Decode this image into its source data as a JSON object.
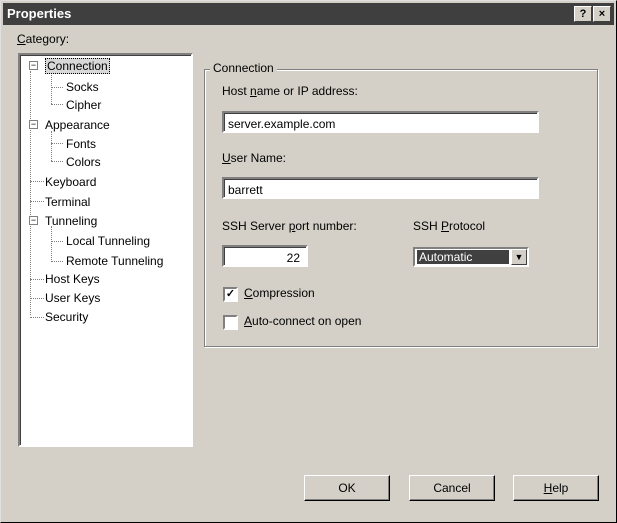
{
  "window": {
    "title": "Properties",
    "help_label": "?",
    "close_label": "×"
  },
  "category": {
    "label_mnemonic": "C",
    "label_rest": "ategory:",
    "items": [
      {
        "label": "Connection",
        "expander": "−"
      },
      {
        "label": "Socks"
      },
      {
        "label": "Cipher"
      },
      {
        "label": "Appearance",
        "expander": "−"
      },
      {
        "label": "Fonts"
      },
      {
        "label": "Colors"
      },
      {
        "label": "Keyboard"
      },
      {
        "label": "Terminal"
      },
      {
        "label": "Tunneling",
        "expander": "−"
      },
      {
        "label": "Local Tunneling"
      },
      {
        "label": "Remote Tunneling"
      },
      {
        "label": "Host Keys"
      },
      {
        "label": "User Keys"
      },
      {
        "label": "Security"
      }
    ],
    "selected": "Connection"
  },
  "connection": {
    "group_title": "Connection",
    "host_label_a": "Host ",
    "host_label_mn": "n",
    "host_label_b": "ame or IP address:",
    "host_value": "server.example.com",
    "user_label_mn": "U",
    "user_label_b": "ser Name:",
    "user_value": "barrett",
    "port_label_a": "SSH Server ",
    "port_label_mn": "p",
    "port_label_b": "ort number:",
    "port_value": "22",
    "protocol_label_a": "SSH ",
    "protocol_label_mn": "P",
    "protocol_label_b": "rotocol",
    "protocol_value": "Automatic",
    "compression_mn": "C",
    "compression_rest": "ompression",
    "compression_checked": "✓",
    "autoconnect_mn": "A",
    "autoconnect_rest": "uto-connect on open",
    "autoconnect_checked": ""
  },
  "buttons": {
    "ok": "OK",
    "cancel": "Cancel",
    "help_mn": "H",
    "help_rest": "elp"
  },
  "colors": {
    "face": "#d4d0c8",
    "titlebar": "#3f3f3f",
    "selection": "#404040"
  }
}
